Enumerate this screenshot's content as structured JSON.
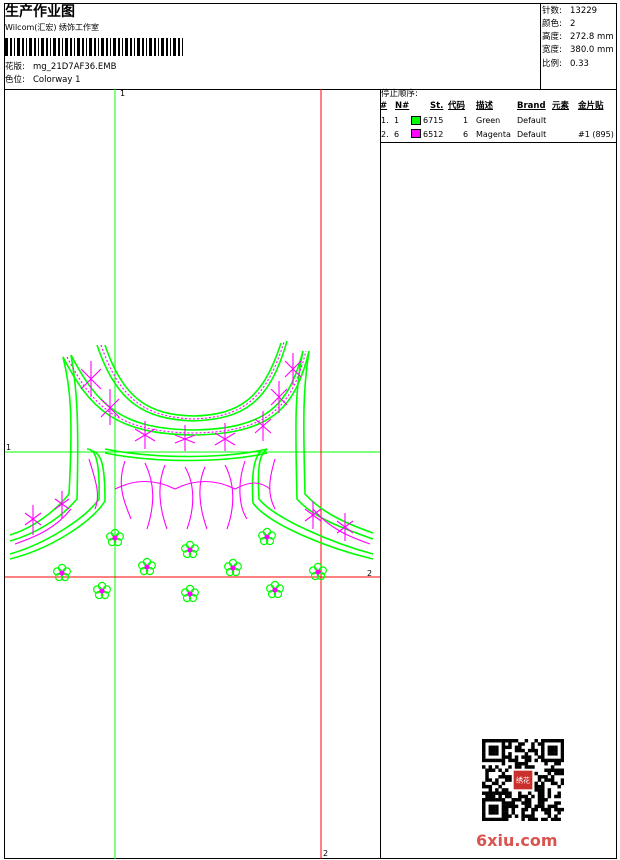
{
  "header": {
    "title": "生产作业图",
    "vendor": "Wilcom(汇宏) 绣饰工作室",
    "design_label": "花版:",
    "design_name": "mg_21D7AF36.EMB",
    "colorway_label": "色位:",
    "colorway_name": "Colorway 1"
  },
  "stats": [
    {
      "label": "针数:",
      "value": "13229"
    },
    {
      "label": "颜色:",
      "value": "2"
    },
    {
      "label": "高度:",
      "value": "272.8 mm"
    },
    {
      "label": "宽度:",
      "value": "380.0 mm"
    },
    {
      "label": "比例:",
      "value": "0.33"
    }
  ],
  "stop_sequence": {
    "title": "停止顺序:",
    "columns": [
      "#",
      "N#",
      "St.",
      "代码",
      "描述",
      "Brand",
      "元素",
      "金片贴"
    ],
    "rows": [
      {
        "num": "1.",
        "n": "1",
        "swatch": "#00ff00",
        "st": "6715",
        "code": "1",
        "desc": "Green",
        "brand": "Default",
        "element": "",
        "sequin": ""
      },
      {
        "num": "2.",
        "n": "6",
        "swatch": "#ff00ff",
        "st": "6512",
        "code": "6",
        "desc": "Magenta",
        "brand": "Default",
        "element": "",
        "sequin": "#1 (895)"
      }
    ]
  },
  "design_view": {
    "guide_labels": {
      "top_green": "1",
      "left_green": "1",
      "right_red": "2",
      "bottom_red": "2"
    },
    "colors": {
      "green": "#00ff00",
      "magenta": "#ff00ff",
      "red_guide": "#ff0000",
      "green_guide": "#00ff00"
    }
  },
  "qr": {
    "icon": "qr-code-icon",
    "seal_text": "绣花"
  },
  "watermark": "6xiu.com"
}
